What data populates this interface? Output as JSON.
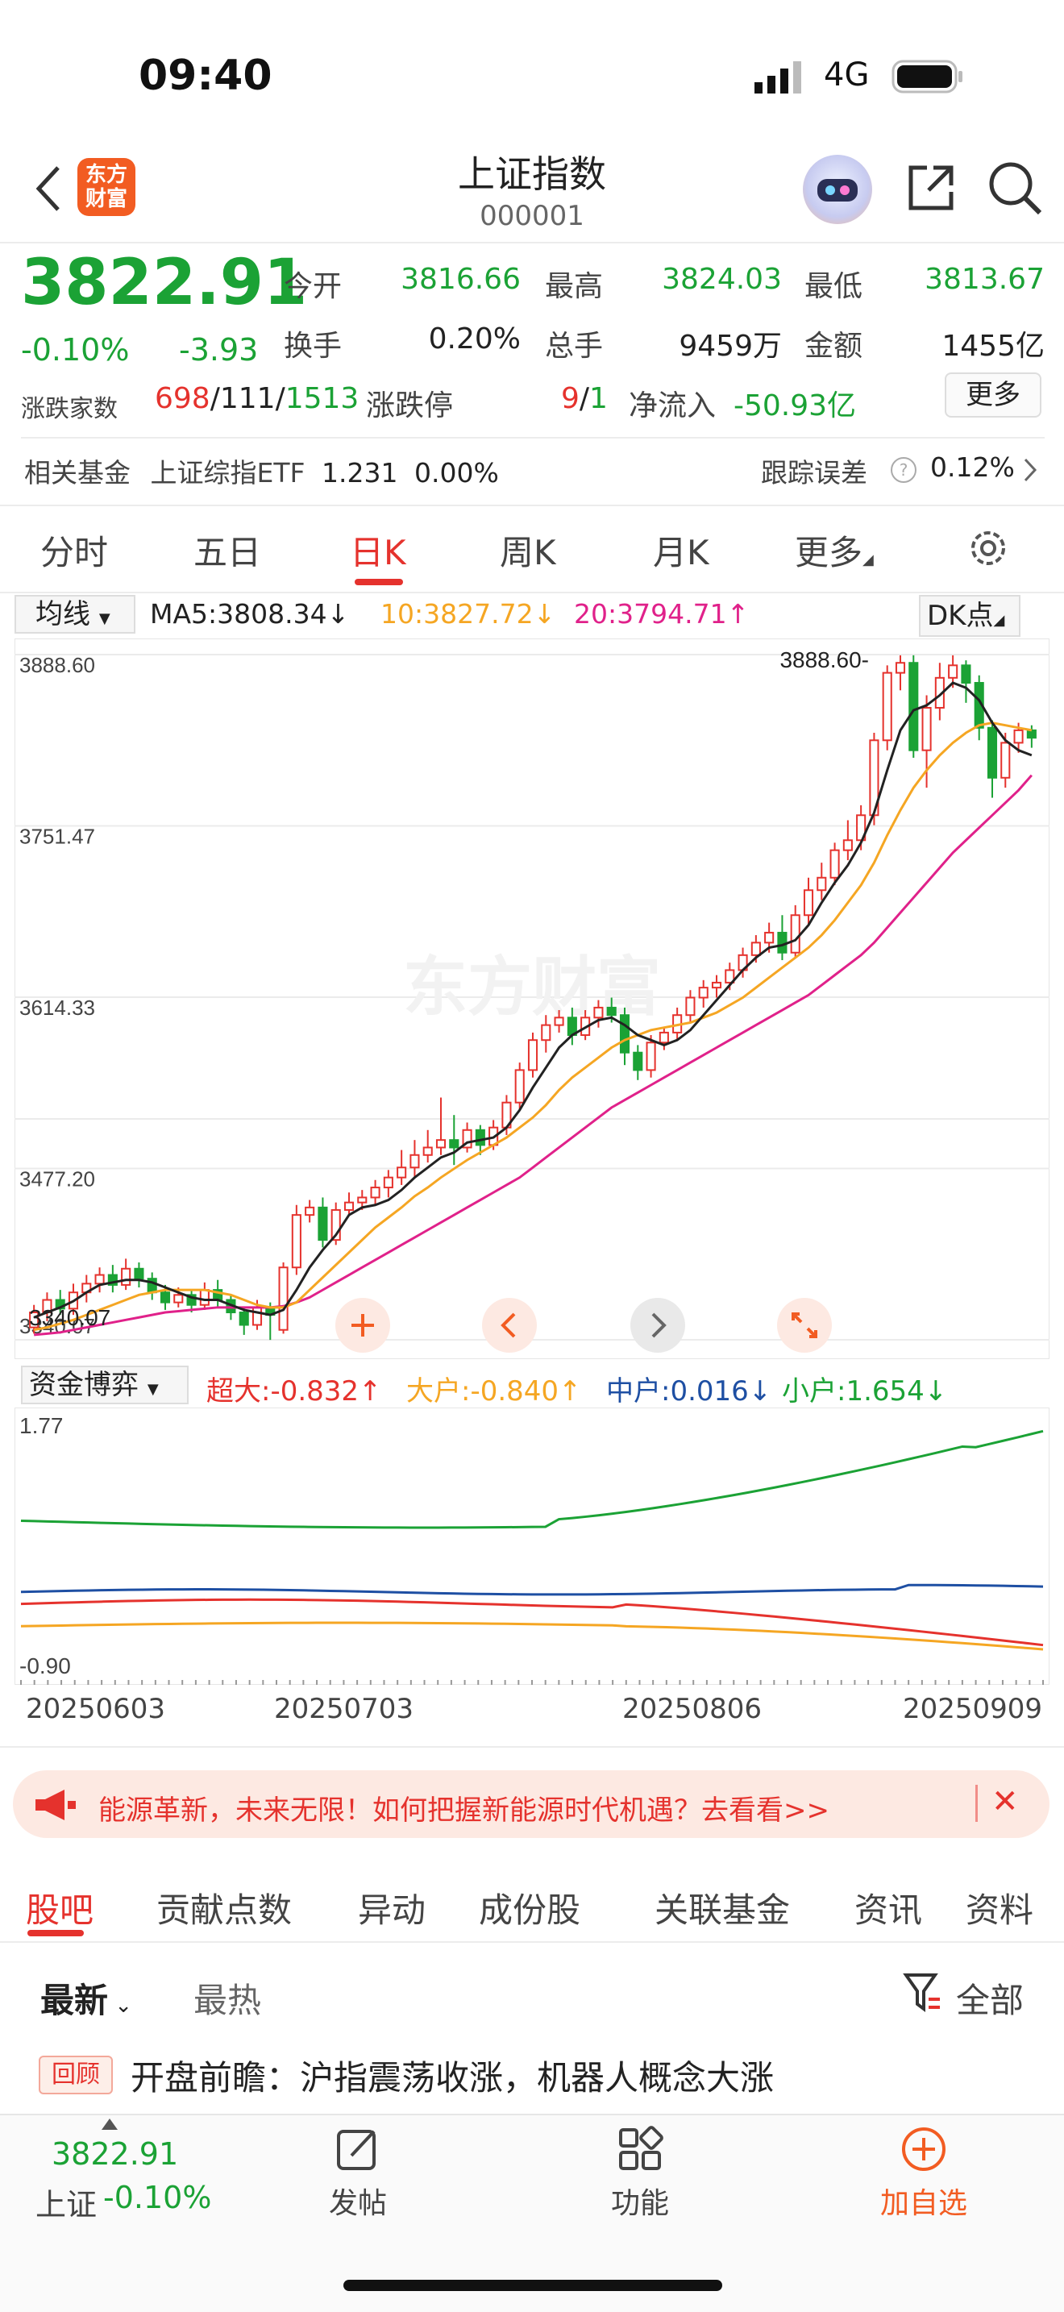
{
  "status_bar": {
    "time": "09:40",
    "network": "4G"
  },
  "header": {
    "logo_text_1": "东方",
    "logo_text_2": "财富",
    "title": "上证指数",
    "code": "000001"
  },
  "quote": {
    "price": "3822.91",
    "change_pct": "-0.10%",
    "change": "-3.93",
    "items": [
      {
        "label": "今开",
        "value": "3816.66",
        "color": "green"
      },
      {
        "label": "最高",
        "value": "3824.03",
        "color": "green"
      },
      {
        "label": "最低",
        "value": "3813.67",
        "color": "green"
      },
      {
        "label": "换手",
        "value": "0.20%",
        "color": "dark"
      },
      {
        "label": "总手",
        "value": "9459万",
        "color": "dark"
      },
      {
        "label": "金额",
        "value": "1455亿",
        "color": "dark"
      }
    ],
    "breadth_label": "涨跌家数",
    "up": "698",
    "flat": "111",
    "down": "1513",
    "limit_label": "涨跌停",
    "limit_up": "9",
    "limit_down": "1",
    "netflow_label": "净流入",
    "netflow": "-50.93亿",
    "more_button": "更多"
  },
  "fund_row": {
    "label": "相关基金",
    "fund_name": "上证综指ETF",
    "fund_price": "1.231",
    "fund_pct": "0.00%",
    "tracking_label": "跟踪误差",
    "tracking_value": "0.12%"
  },
  "chart_tabs": [
    "分时",
    "五日",
    "日K",
    "周K",
    "月K",
    "更多"
  ],
  "ma_bar": {
    "selector": "均线",
    "ma5": "MA5:3808.34↓",
    "ma10": "10:3827.72↓",
    "ma20": "20:3794.71↑",
    "dk": "DK点",
    "colors": {
      "ma5": "#222222",
      "ma10": "#f5a623",
      "ma20": "#e0218a"
    }
  },
  "chart_data": {
    "type": "candlestick",
    "y_ticks": [
      "3888.60",
      "3751.47",
      "3614.33",
      "3477.20",
      "3340.07"
    ],
    "ylim": [
      3340.07,
      3888.6
    ],
    "max_label": "3888.60",
    "min_label": "3340.07",
    "watermark": "东方财富",
    "candles": [
      [
        3350,
        3362,
        3345,
        3368
      ],
      [
        3362,
        3372,
        3355,
        3378
      ],
      [
        3372,
        3365,
        3360,
        3380
      ],
      [
        3365,
        3378,
        3360,
        3385
      ],
      [
        3378,
        3385,
        3370,
        3392
      ],
      [
        3385,
        3392,
        3378,
        3398
      ],
      [
        3392,
        3384,
        3378,
        3400
      ],
      [
        3384,
        3397,
        3380,
        3405
      ],
      [
        3397,
        3389,
        3382,
        3402
      ],
      [
        3389,
        3378,
        3372,
        3394
      ],
      [
        3378,
        3370,
        3364,
        3384
      ],
      [
        3370,
        3376,
        3366,
        3382
      ],
      [
        3376,
        3368,
        3362,
        3380
      ],
      [
        3368,
        3380,
        3364,
        3386
      ],
      [
        3380,
        3372,
        3366,
        3388
      ],
      [
        3372,
        3362,
        3356,
        3376
      ],
      [
        3362,
        3352,
        3344,
        3366
      ],
      [
        3352,
        3366,
        3348,
        3372
      ],
      [
        3366,
        3360,
        3340,
        3370
      ],
      [
        3348,
        3398,
        3345,
        3402
      ],
      [
        3398,
        3440,
        3392,
        3448
      ],
      [
        3440,
        3446,
        3434,
        3452
      ],
      [
        3446,
        3420,
        3414,
        3454
      ],
      [
        3420,
        3444,
        3416,
        3450
      ],
      [
        3444,
        3450,
        3440,
        3458
      ],
      [
        3450,
        3454,
        3444,
        3460
      ],
      [
        3454,
        3462,
        3448,
        3468
      ],
      [
        3462,
        3470,
        3454,
        3476
      ],
      [
        3470,
        3478,
        3464,
        3492
      ],
      [
        3478,
        3488,
        3470,
        3500
      ],
      [
        3488,
        3494,
        3482,
        3508
      ],
      [
        3494,
        3500,
        3488,
        3534
      ],
      [
        3500,
        3494,
        3480,
        3520
      ],
      [
        3494,
        3508,
        3490,
        3514
      ],
      [
        3508,
        3496,
        3488,
        3512
      ],
      [
        3496,
        3510,
        3492,
        3516
      ],
      [
        3510,
        3530,
        3504,
        3536
      ],
      [
        3530,
        3556,
        3524,
        3562
      ],
      [
        3556,
        3580,
        3550,
        3586
      ],
      [
        3580,
        3592,
        3570,
        3600
      ],
      [
        3592,
        3598,
        3586,
        3604
      ],
      [
        3598,
        3584,
        3576,
        3606
      ],
      [
        3584,
        3598,
        3580,
        3604
      ],
      [
        3598,
        3606,
        3590,
        3612
      ],
      [
        3606,
        3600,
        3594,
        3614
      ],
      [
        3600,
        3570,
        3560,
        3606
      ],
      [
        3570,
        3556,
        3548,
        3576
      ],
      [
        3556,
        3578,
        3550,
        3584
      ],
      [
        3578,
        3586,
        3572,
        3590
      ],
      [
        3586,
        3600,
        3580,
        3606
      ],
      [
        3600,
        3614,
        3594,
        3620
      ],
      [
        3614,
        3622,
        3606,
        3628
      ],
      [
        3622,
        3626,
        3614,
        3632
      ],
      [
        3626,
        3636,
        3620,
        3642
      ],
      [
        3636,
        3648,
        3630,
        3654
      ],
      [
        3648,
        3658,
        3642,
        3664
      ],
      [
        3658,
        3666,
        3650,
        3674
      ],
      [
        3666,
        3650,
        3644,
        3680
      ],
      [
        3650,
        3680,
        3646,
        3688
      ],
      [
        3680,
        3700,
        3672,
        3710
      ],
      [
        3700,
        3710,
        3692,
        3722
      ],
      [
        3710,
        3732,
        3704,
        3738
      ],
      [
        3732,
        3740,
        3724,
        3756
      ],
      [
        3740,
        3760,
        3732,
        3768
      ],
      [
        3760,
        3820,
        3752,
        3826
      ],
      [
        3820,
        3874,
        3812,
        3880
      ],
      [
        3874,
        3882,
        3860,
        3888
      ],
      [
        3882,
        3812,
        3806,
        3888
      ],
      [
        3812,
        3846,
        3782,
        3856
      ],
      [
        3846,
        3870,
        3836,
        3882
      ],
      [
        3870,
        3880,
        3862,
        3888
      ],
      [
        3880,
        3866,
        3850,
        3884
      ],
      [
        3866,
        3830,
        3820,
        3872
      ],
      [
        3830,
        3790,
        3774,
        3836
      ],
      [
        3790,
        3818,
        3782,
        3826
      ],
      [
        3818,
        3828,
        3810,
        3834
      ],
      [
        3828,
        3822,
        3814,
        3832
      ]
    ],
    "ma5": [
      3358,
      3362,
      3366,
      3371,
      3378,
      3384,
      3386,
      3388,
      3388,
      3386,
      3382,
      3378,
      3374,
      3372,
      3372,
      3368,
      3364,
      3362,
      3360,
      3364,
      3380,
      3398,
      3412,
      3424,
      3440,
      3446,
      3448,
      3452,
      3460,
      3470,
      3478,
      3486,
      3490,
      3498,
      3500,
      3502,
      3510,
      3524,
      3542,
      3558,
      3574,
      3584,
      3590,
      3596,
      3598,
      3592,
      3584,
      3580,
      3576,
      3580,
      3588,
      3600,
      3612,
      3624,
      3636,
      3646,
      3654,
      3656,
      3660,
      3672,
      3690,
      3706,
      3720,
      3738,
      3762,
      3796,
      3828,
      3844,
      3848,
      3856,
      3866,
      3862,
      3852,
      3834,
      3820,
      3812,
      3808
    ],
    "ma10": [
      3348,
      3350,
      3353,
      3356,
      3360,
      3364,
      3368,
      3372,
      3376,
      3378,
      3380,
      3380,
      3380,
      3380,
      3378,
      3376,
      3372,
      3368,
      3366,
      3366,
      3370,
      3380,
      3390,
      3400,
      3410,
      3420,
      3430,
      3438,
      3446,
      3455,
      3462,
      3470,
      3477,
      3484,
      3490,
      3496,
      3502,
      3510,
      3518,
      3528,
      3540,
      3550,
      3558,
      3566,
      3574,
      3580,
      3584,
      3588,
      3590,
      3592,
      3594,
      3598,
      3602,
      3608,
      3614,
      3622,
      3630,
      3638,
      3646,
      3654,
      3664,
      3676,
      3690,
      3704,
      3722,
      3744,
      3764,
      3782,
      3796,
      3808,
      3818,
      3826,
      3832,
      3834,
      3832,
      3830,
      3828
    ],
    "ma20": [
      3344,
      3345,
      3346,
      3348,
      3350,
      3352,
      3354,
      3356,
      3358,
      3360,
      3362,
      3363,
      3364,
      3365,
      3366,
      3366,
      3366,
      3366,
      3366,
      3367,
      3370,
      3374,
      3380,
      3386,
      3392,
      3398,
      3404,
      3410,
      3416,
      3422,
      3428,
      3434,
      3440,
      3446,
      3452,
      3458,
      3464,
      3470,
      3478,
      3486,
      3494,
      3502,
      3510,
      3518,
      3526,
      3532,
      3538,
      3544,
      3550,
      3556,
      3562,
      3568,
      3574,
      3580,
      3586,
      3592,
      3598,
      3604,
      3610,
      3616,
      3624,
      3632,
      3640,
      3648,
      3658,
      3670,
      3682,
      3694,
      3706,
      3718,
      3730,
      3740,
      3750,
      3760,
      3770,
      3780,
      3792
    ],
    "fund_flow": {
      "label": "资金博弈",
      "ylim": [
        -0.9,
        1.77
      ],
      "y_ticks": [
        "1.77",
        "-0.90"
      ],
      "legend": [
        {
          "name": "超大:-0.832↑",
          "color": "#e5322d"
        },
        {
          "name": "大户:-0.840↑",
          "color": "#f5a623"
        },
        {
          "name": "中户:0.016↓",
          "color": "#1e4fa3"
        },
        {
          "name": "小户:1.654↓",
          "color": "#1ba235"
        }
      ],
      "xaxis_dates": [
        "20250603",
        "20250703",
        "20250806",
        "20250909"
      ]
    }
  },
  "banner": {
    "text": "能源革新，未来无限！如何把握新能源时代机遇？去看看>>",
    "close": "✕"
  },
  "bottom_tabs": [
    "股吧",
    "贡献点数",
    "异动",
    "成份股",
    "关联基金",
    "资讯",
    "资料"
  ],
  "feed": {
    "sort_new": "最新",
    "sort_hot": "最热",
    "filter_all": "全部",
    "post_badge": "回顾",
    "post_title": "开盘前瞻：沪指震荡收涨，机器人概念大涨"
  },
  "bottom_bar": {
    "price": "3822.91",
    "name": "上证",
    "pct": "-0.10%",
    "post": "发帖",
    "function": "功能",
    "add": "加自选"
  },
  "colors": {
    "up": "#e5322d",
    "down": "#1ba235",
    "accent": "#f25c22"
  }
}
